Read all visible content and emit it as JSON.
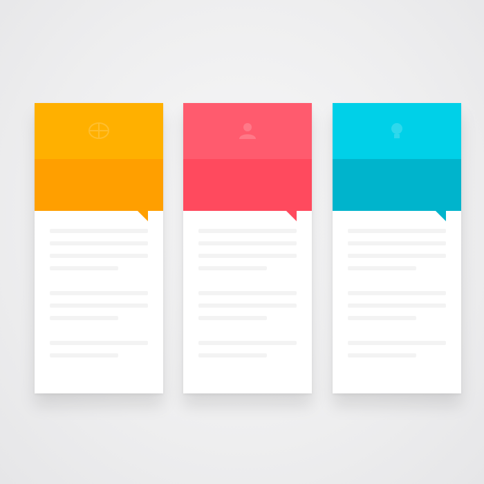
{
  "banners": [
    {
      "heading": "",
      "icon": "world-icon",
      "colors": {
        "top": "#ffb000",
        "bottom": "#ff9f00",
        "pointer": "#ff9f00"
      }
    },
    {
      "heading": "",
      "icon": "user-icon",
      "colors": {
        "top": "#ff5b6e",
        "bottom": "#ff4a5e",
        "pointer": "#ff4a5e"
      }
    },
    {
      "heading": "",
      "icon": "lightbulb-icon",
      "colors": {
        "top": "#00d0e8",
        "bottom": "#00b4cc",
        "pointer": "#00b4cc"
      }
    }
  ]
}
